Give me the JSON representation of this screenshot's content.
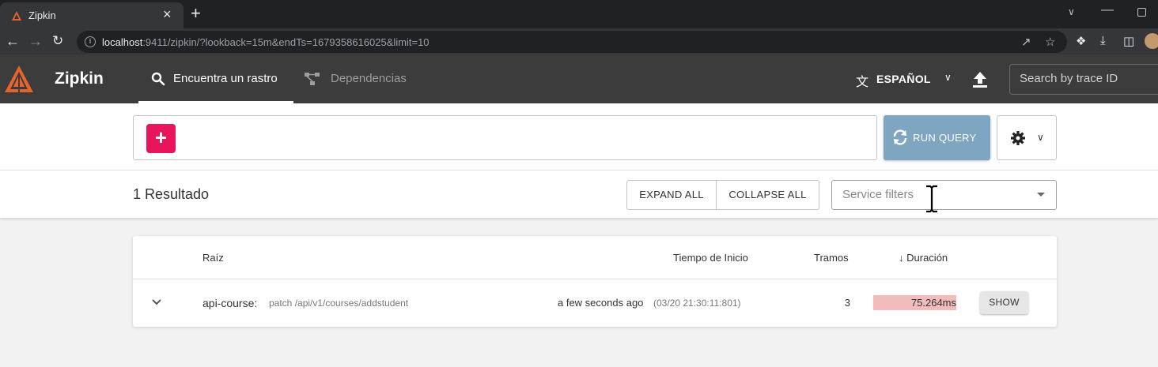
{
  "browser": {
    "tab_title": "Zipkin",
    "new_tab": "+",
    "tab_close": "×",
    "url_host": "localhost",
    "url_rest": ":9411/zipkin/?lookback=15m&endTs=1679358616025&limit=10"
  },
  "header": {
    "brand": "Zipkin",
    "nav_find": "Encuentra un rastro",
    "nav_dependencies": "Dependencias",
    "language": "ESPAÑOL",
    "trace_search_placeholder": "Search by trace ID"
  },
  "query": {
    "add_label": "+",
    "run_label": "RUN QUERY"
  },
  "results": {
    "count_label": "1 Resultado",
    "expand_all": "EXPAND ALL",
    "collapse_all": "COLLAPSE ALL",
    "service_filter_placeholder": "Service filters"
  },
  "table": {
    "columns": {
      "root": "Raíz",
      "start_time": "Tiempo de Inicio",
      "spans": "Tramos",
      "duration": "Duración"
    },
    "rows": [
      {
        "service": "api-course:",
        "span": "patch /api/v1/courses/addstudent",
        "start_relative": "a few seconds ago",
        "start_absolute": "(03/20 21:30:11:801)",
        "spans": "3",
        "duration": "75.264ms",
        "duration_fill_pct": 100,
        "show_label": "SHOW"
      }
    ]
  },
  "colors": {
    "appbar": "#3c3c3c",
    "brand_orange": "#e8632b",
    "add_button": "#e8145c",
    "run_button": "#7ea6c0",
    "duration_bar": "#f2bcbc"
  }
}
